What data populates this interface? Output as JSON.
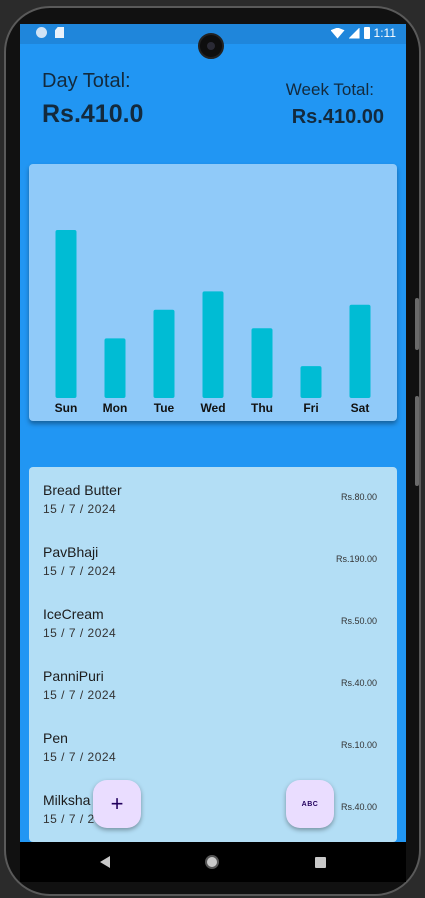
{
  "status_bar": {
    "time": "1:11"
  },
  "header": {
    "day_total_label": "Day Total:",
    "day_total_value": "Rs.410.0",
    "week_total_label": "Week Total:",
    "week_total_value": "Rs.410.00"
  },
  "chart_data": {
    "type": "bar",
    "categories": [
      "Sun",
      "Mon",
      "Tue",
      "Wed",
      "Thu",
      "Fri",
      "Sat"
    ],
    "values": [
      1.0,
      0.355,
      0.525,
      0.635,
      0.415,
      0.19,
      0.555
    ],
    "color": "#00bcd4"
  },
  "transactions": [
    {
      "name": "Bread Butter",
      "date": "15 / 7 / 2024",
      "amount": "Rs.80.00"
    },
    {
      "name": "PavBhaji",
      "date": "15 / 7 / 2024",
      "amount": "Rs.190.00"
    },
    {
      "name": "IceCream",
      "date": "15 / 7 / 2024",
      "amount": "Rs.50.00"
    },
    {
      "name": "PanniPuri",
      "date": "15 / 7 / 2024",
      "amount": "Rs.40.00"
    },
    {
      "name": "Pen",
      "date": "15 / 7 / 2024",
      "amount": "Rs.10.00"
    },
    {
      "name": "Milksha",
      "date": "15 / 7 / 2024",
      "amount": "Rs.40.00"
    }
  ],
  "fab": {
    "add_label": "+",
    "abc_label": "ABC"
  },
  "colors": {
    "accent": "#2196f3",
    "chart_card": "#90caf9",
    "list_card": "#b3def5",
    "fab": "#eaddff"
  },
  "icons": {
    "back": "back-icon",
    "home": "home-icon",
    "recents": "recents-icon"
  }
}
